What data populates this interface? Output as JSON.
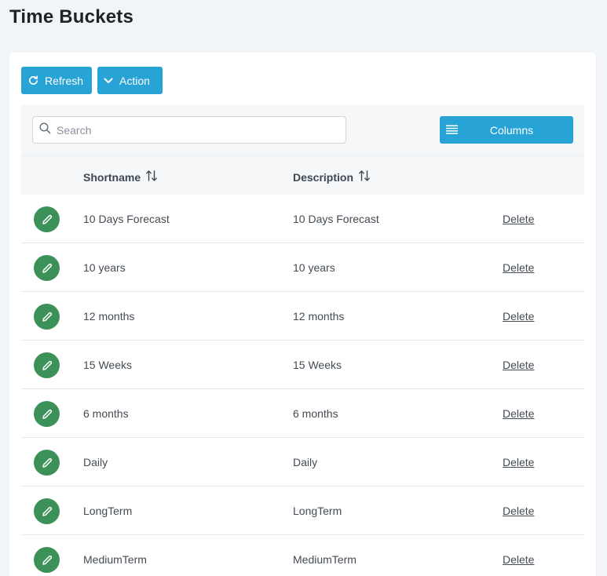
{
  "page": {
    "title": "Time Buckets"
  },
  "toolbar": {
    "refresh_label": "Refresh",
    "action_label": "Action",
    "columns_label": "Columns"
  },
  "search": {
    "placeholder": "Search",
    "value": ""
  },
  "table": {
    "headers": {
      "shortname": "Shortname",
      "description": "Description"
    },
    "delete_label": "Delete",
    "rows": [
      {
        "shortname": "10 Days Forecast",
        "description": "10 Days Forecast"
      },
      {
        "shortname": "10 years",
        "description": "10 years"
      },
      {
        "shortname": "12 months",
        "description": "12 months"
      },
      {
        "shortname": "15 Weeks",
        "description": "15 Weeks"
      },
      {
        "shortname": "6 months",
        "description": "6 months"
      },
      {
        "shortname": "Daily",
        "description": "Daily"
      },
      {
        "shortname": "LongTerm",
        "description": "LongTerm"
      },
      {
        "shortname": "MediumTerm",
        "description": "MediumTerm"
      }
    ]
  },
  "colors": {
    "primary": "#28a3d6",
    "edit_button": "#3c9159",
    "background": "#f2f5f8"
  },
  "icons": {
    "refresh": "refresh-icon",
    "action": "chevron-down-icon",
    "search": "search-icon",
    "columns": "columns-list-icon",
    "sort": "sort-icon",
    "edit": "pencil-icon"
  }
}
